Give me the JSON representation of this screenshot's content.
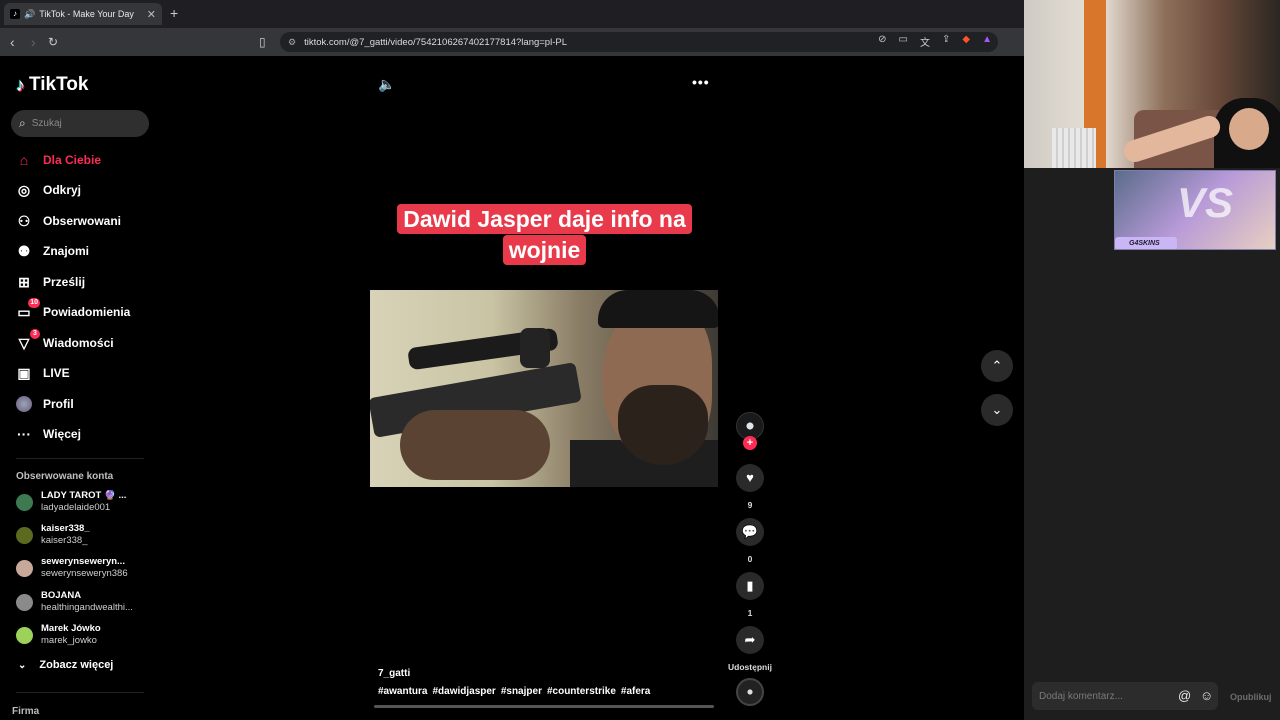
{
  "browser": {
    "tab_title": "TikTok - Make Your Day",
    "url": "tiktok.com/@7_gatti/video/7542106267402177814?lang=pl-PL"
  },
  "tiktok": {
    "logo": "TikTok",
    "search_placeholder": "Szukaj",
    "nav": [
      {
        "label": "Dla Ciebie",
        "icon": "home-icon",
        "active": true
      },
      {
        "label": "Odkryj",
        "icon": "compass-icon"
      },
      {
        "label": "Obserwowani",
        "icon": "following-icon"
      },
      {
        "label": "Znajomi",
        "icon": "friends-icon"
      },
      {
        "label": "Prześlij",
        "icon": "upload-icon"
      },
      {
        "label": "Powiadomienia",
        "icon": "inbox-icon",
        "badge": "10"
      },
      {
        "label": "Wiadomości",
        "icon": "messages-icon",
        "badge": "3"
      },
      {
        "label": "LIVE",
        "icon": "live-icon"
      },
      {
        "label": "Profil",
        "icon": "profile-avatar-icon"
      },
      {
        "label": "Więcej",
        "icon": "more-icon"
      }
    ],
    "following_title": "Obserwowane konta",
    "following": [
      {
        "name": "LADY TAROT 🔮 ...",
        "username": "ladyadelaide001",
        "color": "#3d7a52"
      },
      {
        "name": "kaiser338_",
        "username": "kaiser338_",
        "color": "#5a6b1f"
      },
      {
        "name": "sewerynseweryn...",
        "username": "sewerynseweryn386",
        "color": "#c7a89a"
      },
      {
        "name": "BOJANA",
        "username": "healthingandwealthi...",
        "color": "#8a8a8a"
      },
      {
        "name": "Marek Jówko",
        "username": "marek_jowko",
        "color": "#9cd25a"
      }
    ],
    "see_more": "Zobacz więcej",
    "footer_title": "Firma"
  },
  "video": {
    "caption": "Dawid Jasper daje info na wojnie",
    "author": "7_gatti",
    "hashtags": [
      "#awantura",
      "#dawidjasper",
      "#snajper",
      "#counterstrike",
      "#afera"
    ],
    "likes": "9",
    "comments": "0",
    "saves": "1",
    "share_label": "Udostępnij"
  },
  "right_panel": {
    "promo_tag": "G4SKINS",
    "promo_vs": "VS",
    "comment_placeholder": "Dodaj komentarz...",
    "publish_label": "Opublikuj"
  },
  "colors": {
    "accent": "#fe2c55",
    "caption_bg": "#e83a4a"
  }
}
